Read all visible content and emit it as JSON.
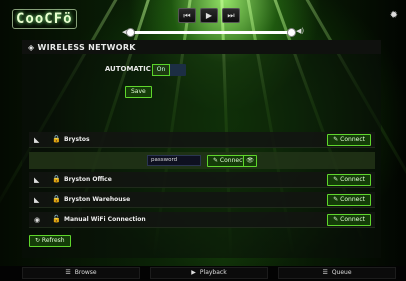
{
  "app": {
    "logo": "CooCFö"
  },
  "transport": {
    "prev_icon": "⏮",
    "play_icon": "▶",
    "next_icon": "⏭",
    "volume": 1.0
  },
  "panel": {
    "title": "WIRELESS NETWORK",
    "automatic_ip_label": "AUTOMATIC IP",
    "automatic_ip_value": "On",
    "save_label": "Save"
  },
  "networks": [
    {
      "name": "Brystos",
      "connect_label": "✎ Connect"
    },
    {
      "name": "Bryston Office",
      "connect_label": "✎ Connect"
    },
    {
      "name": "Bryston Warehouse",
      "connect_label": "✎ Connect"
    },
    {
      "name": "Manual WiFi Connection",
      "connect_label": "✎ Connect"
    }
  ],
  "password": {
    "value": "password",
    "connect_label": "✎ Connect",
    "show_icon": "👁"
  },
  "refresh_label": "↻ Refresh",
  "footer": {
    "browse": "Browse",
    "playback": "Playback",
    "queue": "Queue"
  },
  "colors": {
    "accent": "#5fd62c",
    "panel_header": "#0f110e"
  }
}
